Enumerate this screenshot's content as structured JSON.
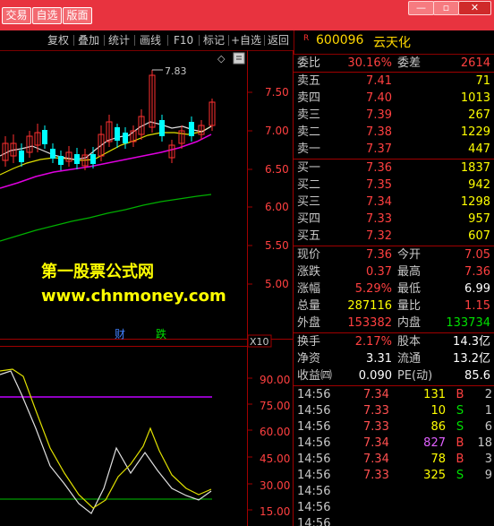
{
  "titlebar": {
    "buttons": [
      "交易",
      "自选",
      "版面"
    ],
    "window_controls": [
      "—",
      "▫",
      "✕"
    ]
  },
  "toolbar": {
    "items": [
      "复权",
      "叠加",
      "统计",
      "画线",
      "F10",
      "标记",
      "+自选",
      "返回"
    ]
  },
  "chart": {
    "high_marker": "7.83",
    "price_axis": [
      "7.50",
      "7.00",
      "6.50",
      "6.00",
      "5.50",
      "5.00"
    ],
    "badges": [
      "财",
      "跌"
    ],
    "indicator_label": "X10",
    "indicator_axis": [
      "90.00",
      "75.00",
      "60.00",
      "45.00",
      "30.00",
      "15.00"
    ],
    "watermark_line1": "第一股票公式网",
    "watermark_line2": "www.chnmoney.com",
    "colors": {
      "up": "#ff3030",
      "down": "#00ffff",
      "ma1": "#ffffff",
      "ma2": "#ffff00",
      "ma3": "#ff00ff",
      "ma4": "#00c000",
      "purple_line": "#c000ff"
    }
  },
  "stock": {
    "flag": "R",
    "code": "600096",
    "name": "云天化"
  },
  "book": {
    "ratio_label": "委比",
    "ratio_value": "30.16%",
    "diff_label": "委差",
    "diff_value": "2614",
    "asks": [
      {
        "label": "卖五",
        "price": "7.41",
        "vol": "71"
      },
      {
        "label": "卖四",
        "price": "7.40",
        "vol": "1013"
      },
      {
        "label": "卖三",
        "price": "7.39",
        "vol": "267"
      },
      {
        "label": "卖二",
        "price": "7.38",
        "vol": "1229"
      },
      {
        "label": "卖一",
        "price": "7.37",
        "vol": "447"
      }
    ],
    "bids": [
      {
        "label": "买一",
        "price": "7.36",
        "vol": "1837"
      },
      {
        "label": "买二",
        "price": "7.35",
        "vol": "942"
      },
      {
        "label": "买三",
        "price": "7.34",
        "vol": "1298"
      },
      {
        "label": "买四",
        "price": "7.33",
        "vol": "957"
      },
      {
        "label": "买五",
        "price": "7.32",
        "vol": "607"
      }
    ]
  },
  "quote": [
    {
      "l1": "现价",
      "v1": "7.36",
      "c1": "red",
      "l2": "今开",
      "v2": "7.05",
      "c2": "red"
    },
    {
      "l1": "涨跌",
      "v1": "0.37",
      "c1": "red",
      "l2": "最高",
      "v2": "7.36",
      "c2": "red"
    },
    {
      "l1": "涨幅",
      "v1": "5.29%",
      "c1": "red",
      "l2": "最低",
      "v2": "6.99",
      "c2": "white"
    },
    {
      "l1": "总量",
      "v1": "287116",
      "c1": "yellow",
      "l2": "量比",
      "v2": "1.15",
      "c2": "red"
    },
    {
      "l1": "外盘",
      "v1": "153382",
      "c1": "red",
      "l2": "内盘",
      "v2": "133734",
      "c2": "green"
    }
  ],
  "fund": [
    {
      "l1": "换手",
      "v1": "2.17%",
      "l2": "股本",
      "v2": "14.3亿"
    },
    {
      "l1": "净资",
      "v1": "3.31",
      "l2": "流通",
      "v2": "13.2亿"
    },
    {
      "l1": "收益㈣",
      "v1": "0.090",
      "l2": "PE(动)",
      "v2": "85.6"
    }
  ],
  "ticks": [
    {
      "time": "14:56",
      "price": "7.34",
      "vol": "131",
      "vc": "yellow",
      "bs": "B",
      "bc": "red",
      "n": "2"
    },
    {
      "time": "14:56",
      "price": "7.33",
      "vol": "10",
      "vc": "yellow",
      "bs": "S",
      "bc": "green",
      "n": "1"
    },
    {
      "time": "14:56",
      "price": "7.33",
      "vol": "86",
      "vc": "yellow",
      "bs": "S",
      "bc": "green",
      "n": "6"
    },
    {
      "time": "14:56",
      "price": "7.34",
      "vol": "827",
      "vc": "purple",
      "bs": "B",
      "bc": "red",
      "n": "18"
    },
    {
      "time": "14:56",
      "price": "7.34",
      "vol": "78",
      "vc": "yellow",
      "bs": "B",
      "bc": "red",
      "n": "3"
    },
    {
      "time": "14:56",
      "price": "7.33",
      "vol": "325",
      "vc": "yellow",
      "bs": "S",
      "bc": "green",
      "n": "9"
    },
    {
      "time": "14:56",
      "price": "",
      "vol": "",
      "vc": "yellow",
      "bs": "",
      "bc": "red",
      "n": ""
    },
    {
      "time": "14:56",
      "price": "",
      "vol": "",
      "vc": "yellow",
      "bs": "",
      "bc": "red",
      "n": ""
    },
    {
      "time": "14:56",
      "price": "",
      "vol": "",
      "vc": "yellow",
      "bs": "",
      "bc": "red",
      "n": ""
    }
  ]
}
